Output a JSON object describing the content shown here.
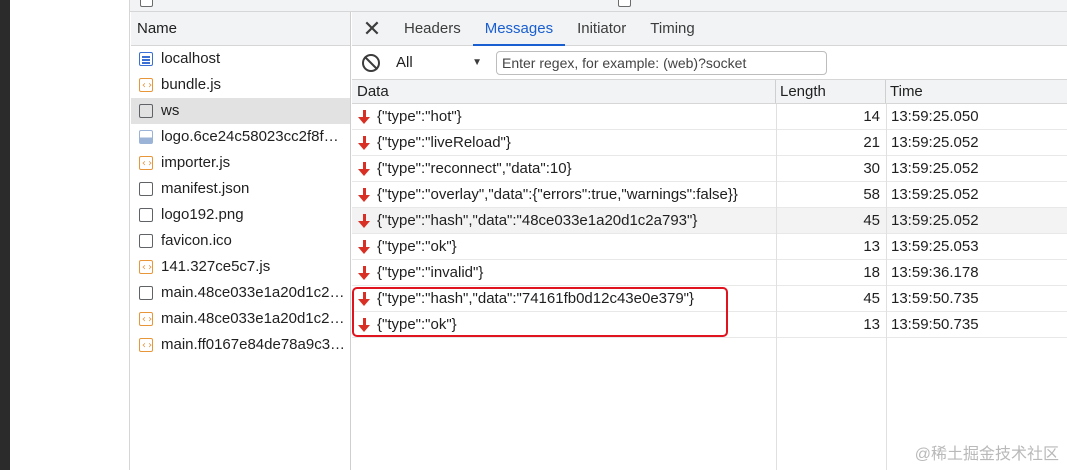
{
  "name_panel": {
    "header": "Name",
    "items": [
      {
        "label": "localhost",
        "icon": "document-icon",
        "kind": "doc"
      },
      {
        "label": "bundle.js",
        "icon": "script-icon",
        "kind": "script"
      },
      {
        "label": "ws",
        "icon": "websocket-icon",
        "kind": "plain",
        "selected": true
      },
      {
        "label": "logo.6ce24c58023cc2f8f…",
        "icon": "image-icon",
        "kind": "img"
      },
      {
        "label": "importer.js",
        "icon": "script-icon",
        "kind": "script"
      },
      {
        "label": "manifest.json",
        "icon": "file-icon",
        "kind": "plain"
      },
      {
        "label": "logo192.png",
        "icon": "file-icon",
        "kind": "plain"
      },
      {
        "label": "favicon.ico",
        "icon": "file-icon",
        "kind": "plain"
      },
      {
        "label": "141.327ce5c7.js",
        "icon": "script-icon",
        "kind": "script"
      },
      {
        "label": "main.48ce033e1a20d1c2…",
        "icon": "file-icon",
        "kind": "plain"
      },
      {
        "label": "main.48ce033e1a20d1c2…",
        "icon": "script-icon",
        "kind": "script"
      },
      {
        "label": "main.ff0167e84de78a9c3…",
        "icon": "script-icon",
        "kind": "script"
      }
    ]
  },
  "tabs": {
    "close": "✕",
    "items": [
      {
        "label": "Headers",
        "active": false
      },
      {
        "label": "Messages",
        "active": true
      },
      {
        "label": "Initiator",
        "active": false
      },
      {
        "label": "Timing",
        "active": false
      }
    ]
  },
  "filter": {
    "select_value": "All",
    "regex_placeholder": "Enter regex, for example: (web)?socket"
  },
  "columns": {
    "data": "Data",
    "length": "Length",
    "time": "Time"
  },
  "messages": [
    {
      "data": "{\"type\":\"hot\"}",
      "length": "14",
      "time": "13:59:25.050"
    },
    {
      "data": "{\"type\":\"liveReload\"}",
      "length": "21",
      "time": "13:59:25.052"
    },
    {
      "data": "{\"type\":\"reconnect\",\"data\":10}",
      "length": "30",
      "time": "13:59:25.052"
    },
    {
      "data": "{\"type\":\"overlay\",\"data\":{\"errors\":true,\"warnings\":false}}",
      "length": "58",
      "time": "13:59:25.052"
    },
    {
      "data": "{\"type\":\"hash\",\"data\":\"48ce033e1a20d1c2a793\"}",
      "length": "45",
      "time": "13:59:25.052",
      "shaded": true
    },
    {
      "data": "{\"type\":\"ok\"}",
      "length": "13",
      "time": "13:59:25.053"
    },
    {
      "data": "{\"type\":\"invalid\"}",
      "length": "18",
      "time": "13:59:36.178"
    },
    {
      "data": "{\"type\":\"hash\",\"data\":\"74161fb0d12c43e0e379\"}",
      "length": "45",
      "time": "13:59:50.735"
    },
    {
      "data": "{\"type\":\"ok\"}",
      "length": "13",
      "time": "13:59:50.735"
    }
  ],
  "watermark": "@稀土掘金技术社区",
  "colors": {
    "accent": "#1a5fd1",
    "received_arrow": "#d93025",
    "highlight": "#e0141e"
  }
}
